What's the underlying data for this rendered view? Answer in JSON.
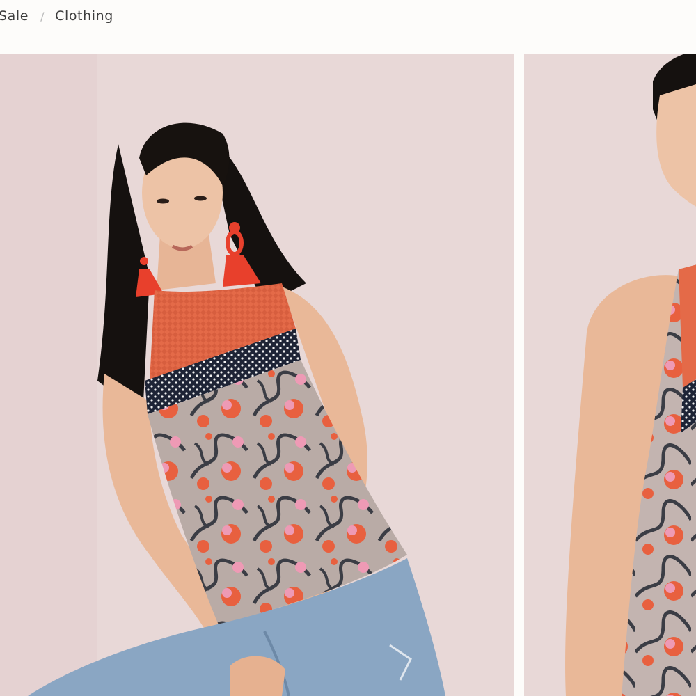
{
  "breadcrumb": {
    "items": [
      {
        "label": "Sale"
      },
      {
        "label": "Clothing"
      }
    ],
    "separator": "/"
  },
  "gallery": {
    "images": [
      {
        "view": "front",
        "icon": "product-photo-front"
      },
      {
        "view": "back",
        "icon": "product-photo-back"
      }
    ]
  },
  "colors": {
    "page_background": "#fdfcfa",
    "photo_backdrop": "#e8d8d7",
    "top_orange": "#e8603f",
    "top_navy": "#1e2436",
    "top_gray": "#b9aba6",
    "top_pink": "#ee9ab5",
    "denim": "#8aa6c3",
    "earring_red": "#e8402c"
  }
}
